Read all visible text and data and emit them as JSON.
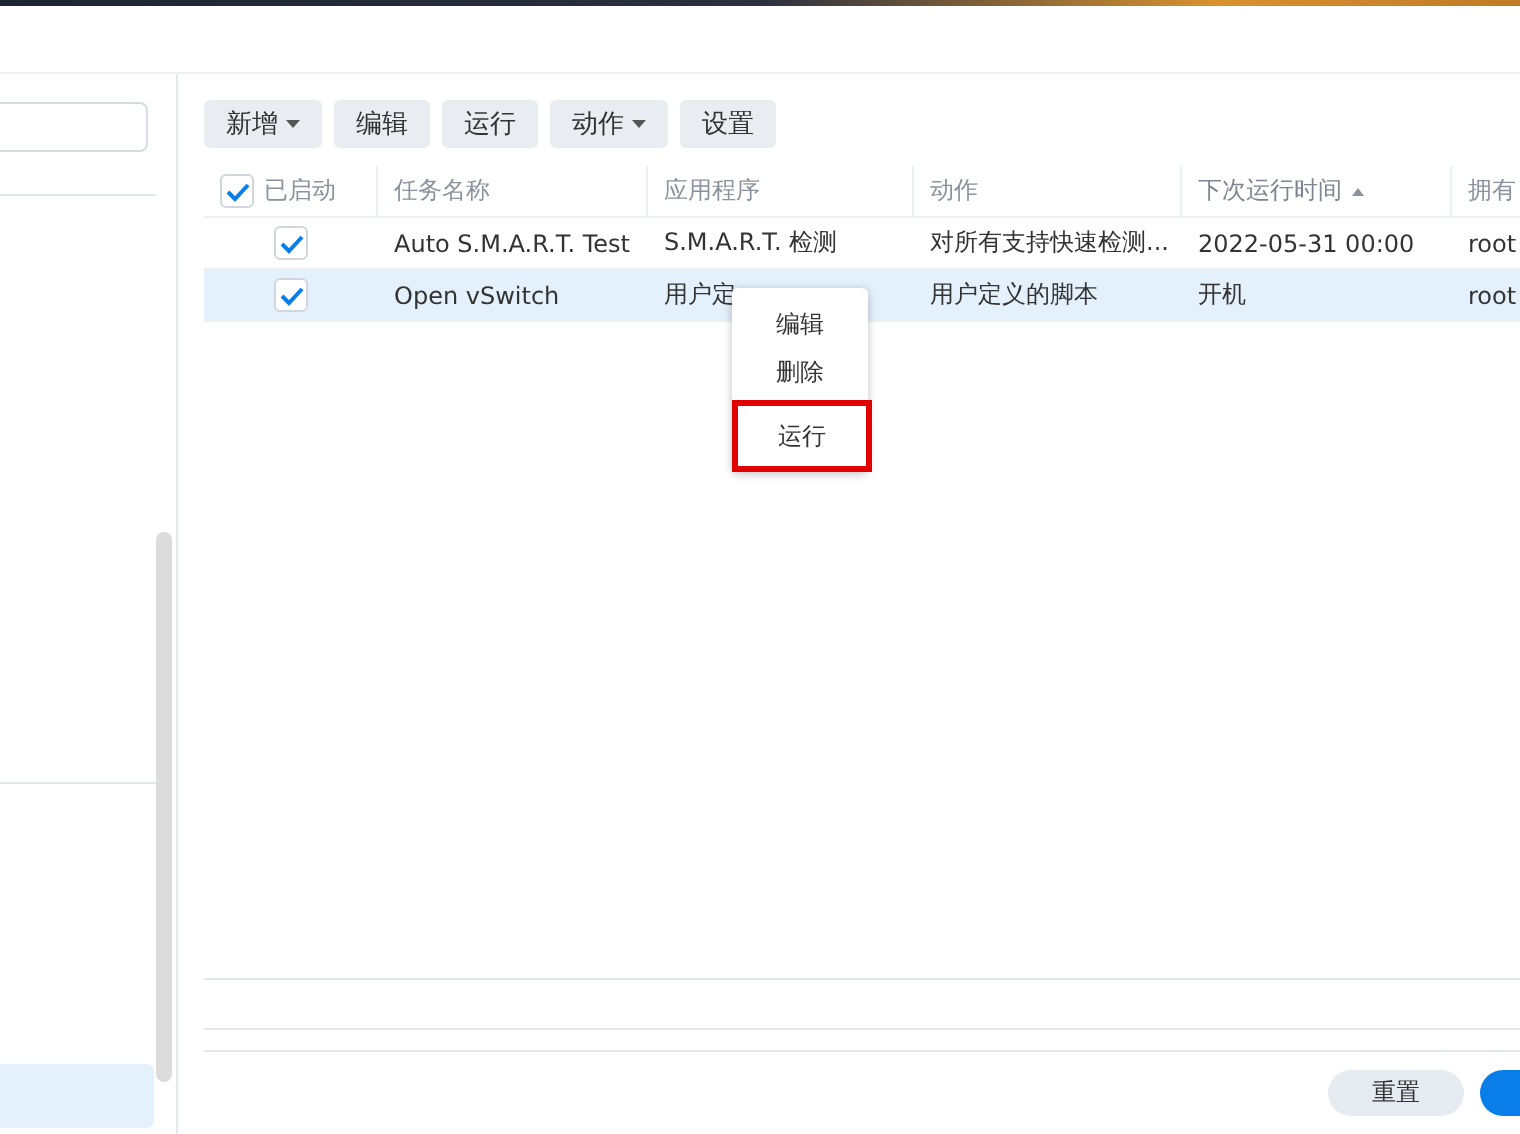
{
  "toolbar": [
    {
      "label": "新增",
      "dropdown": true
    },
    {
      "label": "编辑",
      "dropdown": false
    },
    {
      "label": "运行",
      "dropdown": false
    },
    {
      "label": "动作",
      "dropdown": true
    },
    {
      "label": "设置",
      "dropdown": false
    }
  ],
  "table": {
    "enabled_header": "已启动",
    "all_checked": true,
    "columns": [
      {
        "label": "任务名称",
        "sorted": false
      },
      {
        "label": "应用程序",
        "sorted": false
      },
      {
        "label": "动作",
        "sorted": false
      },
      {
        "label": "下次运行时间",
        "sorted": true
      },
      {
        "label": "拥有",
        "sorted": false
      }
    ],
    "rows": [
      {
        "enabled": true,
        "selected": false,
        "cells": [
          "Auto S.M.A.R.T. Test",
          "S.M.A.R.T. 检测",
          "对所有支持快速检测...",
          "2022-05-31 00:00",
          "root"
        ]
      },
      {
        "enabled": true,
        "selected": true,
        "cells": [
          "Open vSwitch",
          "用户定",
          "用户定义的脚本",
          "开机",
          "root"
        ]
      }
    ]
  },
  "context_menu": [
    {
      "label": "编辑",
      "highlighted": false
    },
    {
      "label": "删除",
      "highlighted": false
    },
    {
      "label": "运行",
      "highlighted": true
    }
  ],
  "footer": {
    "reset_button": "重置"
  }
}
